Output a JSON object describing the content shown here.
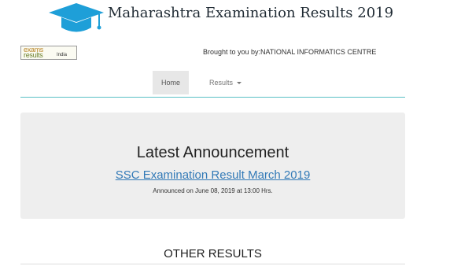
{
  "header": {
    "title": "Maharashtra Examination Results 2019",
    "logo_icon": "graduation-cap-icon",
    "accent_color": "#1e9fd8"
  },
  "logo": {
    "line1": "exams",
    "line2": "results",
    "line3": "India"
  },
  "brought_by": "Brought to you by:NATIONAL INFORMATICS CENTRE",
  "nav": {
    "home": "Home",
    "results": "Results"
  },
  "announcement": {
    "heading": "Latest Announcement",
    "link": "SSC Examination Result March 2019",
    "date": "Announced on June 08, 2019 at 13:00 Hrs."
  },
  "other_results": "OTHER RESULTS"
}
